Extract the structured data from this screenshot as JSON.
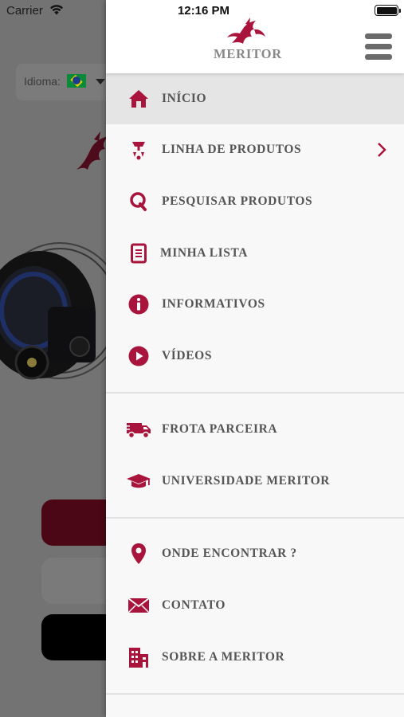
{
  "status_bar": {
    "carrier": "Carrier",
    "time": "12:16 PM"
  },
  "background_app": {
    "language_label": "Idioma:",
    "language_flag": "brazil-flag"
  },
  "header": {
    "brand": "MERITOR",
    "menu_icon": "hamburger-icon"
  },
  "menu": {
    "items": [
      {
        "label": "INÍCIO",
        "icon": "home-icon",
        "active": true
      },
      {
        "label": "LINHA DE PRODUTOS",
        "icon": "product-line-icon",
        "has_submenu": true
      },
      {
        "label": "PESQUISAR PRODUTOS",
        "icon": "search-icon"
      },
      {
        "label": "MINHA LISTA",
        "icon": "list-icon"
      },
      {
        "label": "INFORMATIVOS",
        "icon": "info-icon"
      },
      {
        "label": "VÍDEOS",
        "icon": "play-icon"
      },
      {
        "label": "FROTA PARCEIRA",
        "icon": "truck-icon"
      },
      {
        "label": "UNIVERSIDADE MERITOR",
        "icon": "graduation-cap-icon"
      },
      {
        "label": "ONDE ENCONTRAR ?",
        "icon": "location-pin-icon"
      },
      {
        "label": "CONTATO",
        "icon": "envelope-icon"
      },
      {
        "label": "SOBRE A MERITOR",
        "icon": "building-icon"
      }
    ]
  },
  "colors": {
    "accent": "#a8143c",
    "label": "#555555",
    "active_row": "#e5e5e5"
  }
}
